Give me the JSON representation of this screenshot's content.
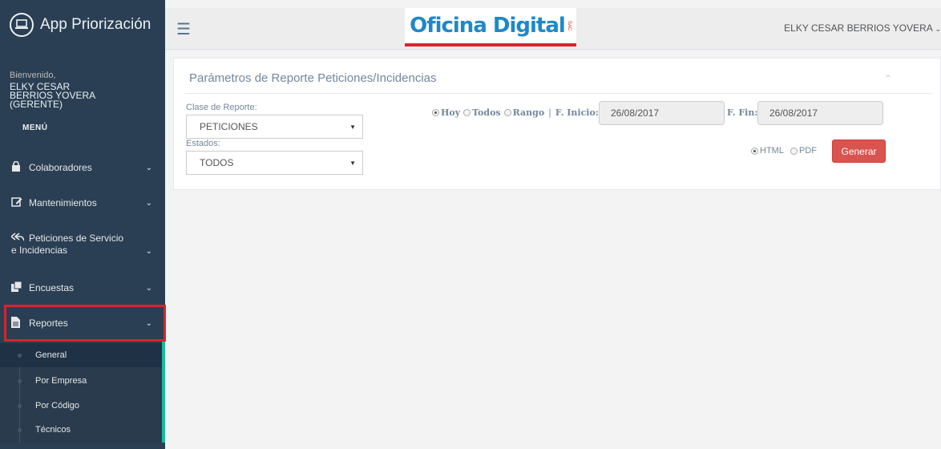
{
  "app": {
    "title": "App Priorización"
  },
  "welcome": {
    "label": "Bienvenido,",
    "user": "ELKY CESAR BERRIOS YOVERA (GERENTE)"
  },
  "menu": {
    "title": "MENÚ",
    "items": [
      {
        "label": "Colaboradores",
        "icon": "lock-icon"
      },
      {
        "label": "Mantenimientos",
        "icon": "edit-icon"
      },
      {
        "label": "Peticiones de Servicio e Incidencias",
        "icon": "reply-all-icon"
      },
      {
        "label": "Encuestas",
        "icon": "clone-icon"
      },
      {
        "label": "Reportes",
        "icon": "file-icon"
      }
    ],
    "submenu": [
      "General",
      "Por Empresa",
      "Por Código",
      "Técnicos"
    ]
  },
  "header": {
    "logo_text": "Oficina Digital",
    "logo_suffix": "SAC",
    "user": "ELKY CESAR BERRIOS YOVERA"
  },
  "panel": {
    "title": "Parámetros de Reporte Peticiones/Incidencias",
    "clase_label": "Clase de Reporte:",
    "clase_value": "PETICIONES",
    "estados_label": "Estados:",
    "estados_value": "TODOS",
    "range_options": [
      "Hoy",
      "Todos",
      "Rango"
    ],
    "range_selected": "Hoy",
    "f_inicio_label": "F. Inicio:",
    "f_inicio_value": "26/08/2017",
    "f_fin_label": "F. Fin:",
    "f_fin_value": "26/08/2017",
    "formats": [
      "HTML",
      "PDF"
    ],
    "format_selected": "HTML",
    "generate_label": "Generar"
  },
  "colors": {
    "sidebar": "#2a3f54",
    "accent": "#1abb9c",
    "danger": "#d9534f",
    "highlight": "#d9232d"
  }
}
